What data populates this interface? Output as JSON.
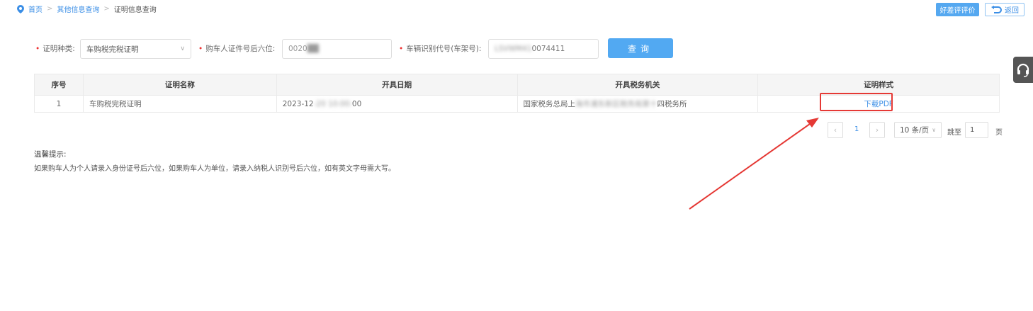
{
  "breadcrumb": {
    "items": [
      "首页",
      "其他信息查询",
      "证明信息查询"
    ],
    "sep": ">"
  },
  "top": {
    "evaluate": "好差评评价",
    "back": "返回"
  },
  "form": {
    "type_label": "证明种类:",
    "type_value": "车购税完税证明",
    "id_label": "购车人证件号后六位:",
    "id_value_visible": "0020",
    "id_value_blurred": "██",
    "vin_label": "车辆识别代号(车架号):",
    "vin_value_blurred": "LSVWM41",
    "vin_value_visible": "0074411",
    "query": "查询"
  },
  "table": {
    "headers": [
      "序号",
      "证明名称",
      "开具日期",
      "开具税务机关",
      "证明样式"
    ],
    "rows": [
      {
        "index": "1",
        "name": "车购税完税证明",
        "date_prefix": "2023-12",
        "date_blur": "-20 10:00:",
        "date_suffix": "00",
        "office_prefix": "国家税务总局上",
        "office_blur": "海市浦东新区税务局第十",
        "office_suffix": "四税务所",
        "action": "下载PDF"
      }
    ]
  },
  "pagination": {
    "current": "1",
    "page_size": "10 条/页",
    "goto_label": "跳至",
    "goto_value": "1",
    "page_unit": "页"
  },
  "tips": {
    "title": "温馨提示:",
    "text": "如果购车人为个人请录入身份证号后六位，如果购车人为单位，请录入纳税人识别号后六位，如有英文字母需大写。"
  },
  "annotation": {
    "color": "#e53935"
  }
}
